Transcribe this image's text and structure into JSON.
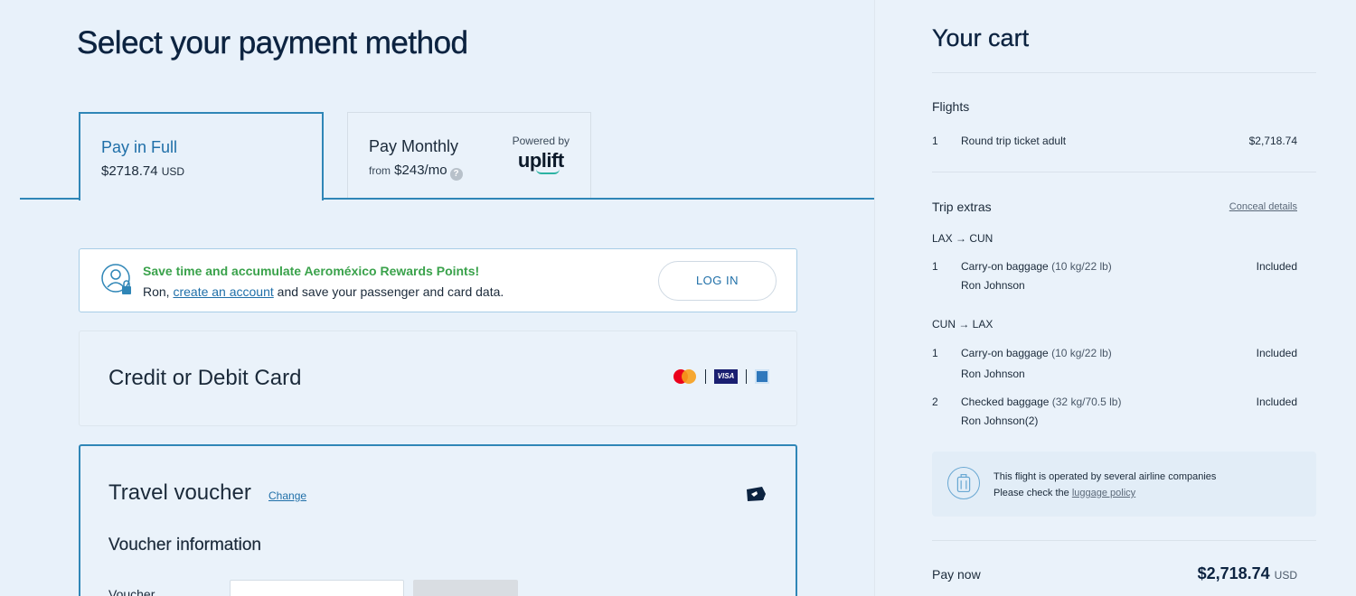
{
  "page": {
    "title": "Select your payment method"
  },
  "tabs": {
    "full": {
      "label": "Pay in Full",
      "amount": "$2718.74",
      "currency": "USD"
    },
    "monthly": {
      "label": "Pay Monthly",
      "from_prefix": "from",
      "amount": "$243/mo",
      "help": "?",
      "powered_by": "Powered by",
      "brand": "uplift"
    }
  },
  "rewards": {
    "headline": "Save time and accumulate Aeroméxico Rewards Points!",
    "text_prefix": "Ron, ",
    "link": "create an account",
    "text_suffix": " and save your passenger and card data.",
    "login_label": "LOG IN"
  },
  "card": {
    "title": "Credit or Debit Card",
    "brands": [
      "mastercard-icon",
      "visa-icon",
      "amex-icon"
    ],
    "visa_text": "VISA"
  },
  "voucher": {
    "title": "Travel voucher",
    "change_label": "Change",
    "info_title": "Voucher information",
    "field_label": "Voucher"
  },
  "cart": {
    "title": "Your cart",
    "flights": {
      "heading": "Flights",
      "items": [
        {
          "qty": "1",
          "desc": "Round trip ticket adult",
          "price": "$2,718.74"
        }
      ]
    },
    "extras": {
      "heading": "Trip extras",
      "conceal_label": "Conceal details",
      "legs": [
        {
          "route": "LAX → CUN",
          "items": [
            {
              "qty": "1",
              "desc": "Carry-on baggage",
              "detail": "(10 kg/22 lb)",
              "passenger": "Ron Johnson",
              "status": "Included"
            }
          ]
        },
        {
          "route": "CUN → LAX",
          "items": [
            {
              "qty": "1",
              "desc": "Carry-on baggage",
              "detail": "(10 kg/22 lb)",
              "passenger": "Ron Johnson",
              "status": "Included"
            },
            {
              "qty": "2",
              "desc": "Checked baggage",
              "detail": "(32 kg/70.5 lb)",
              "passenger": "Ron Johnson(2)",
              "status": "Included"
            }
          ]
        }
      ]
    },
    "notice": {
      "line1": "This flight is operated by several airline companies",
      "line2_prefix": "Please check the ",
      "line2_link": "luggage policy"
    },
    "pay_now": {
      "label": "Pay now",
      "amount": "$2,718.74",
      "currency": "USD"
    }
  },
  "colors": {
    "accent": "#2f86b7",
    "link": "#1f6fa8",
    "rewards_green": "#3aa24b",
    "title": "#0c2340"
  }
}
